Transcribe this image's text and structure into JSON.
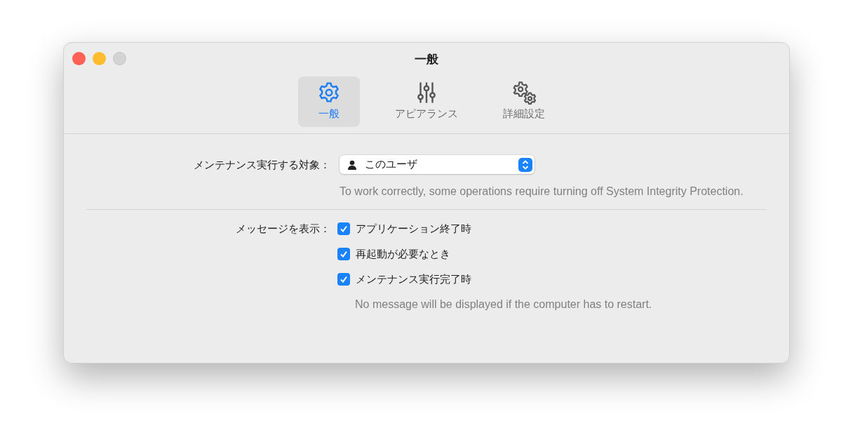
{
  "window": {
    "title": "一般"
  },
  "tabs": [
    {
      "label": "一般",
      "selected": true
    },
    {
      "label": "アピアランス",
      "selected": false
    },
    {
      "label": "詳細設定",
      "selected": false
    }
  ],
  "target": {
    "label": "メンテナンス実行する対象：",
    "value": "このユーザ",
    "hint": "To work correctly, some operations require turning off System Integrity Protection."
  },
  "messages": {
    "label": "メッセージを表示：",
    "options": [
      {
        "label": "アプリケーション終了時",
        "checked": true
      },
      {
        "label": "再起動が必要なとき",
        "checked": true
      },
      {
        "label": "メンテナンス実行完了時",
        "checked": true
      }
    ],
    "note": "No message will be displayed if the computer has to restart."
  }
}
